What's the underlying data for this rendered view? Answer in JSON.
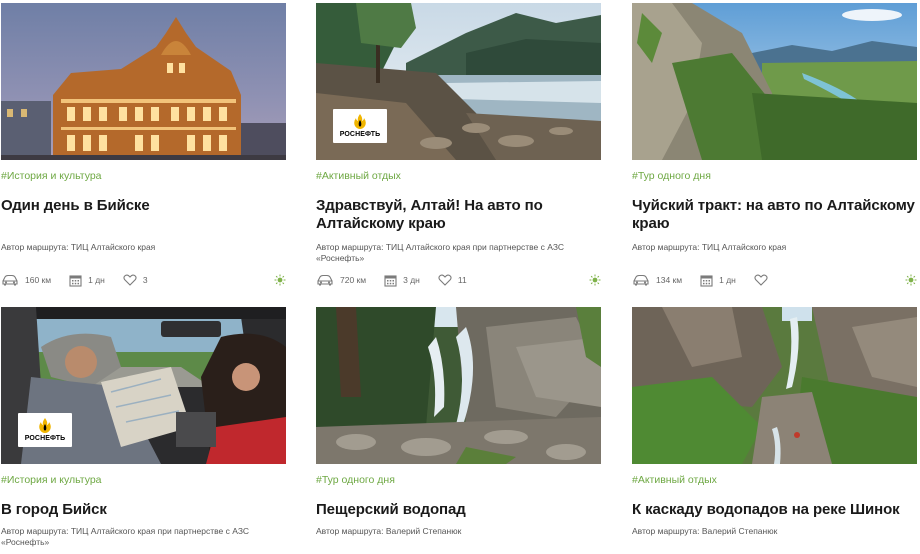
{
  "cards": [
    {
      "tag": "#История и культура",
      "title": "Один день в Бийске",
      "author": "Автор маршрута: ТИЦ Алтайского края",
      "distance": "160 км",
      "duration": "1 дн",
      "likes": "3",
      "sponsor_logo": false
    },
    {
      "tag": "#Активный отдых",
      "title": "Здравствуй, Алтай! На авто по Алтайскому краю",
      "author": "Автор маршрута: ТИЦ Алтайского края при партнерстве с АЗС «Роснефть»",
      "distance": "720 км",
      "duration": "3 дн",
      "likes": "11",
      "sponsor_logo": true
    },
    {
      "tag": "#Тур одного дня",
      "title": "Чуйский тракт: на авто по Алтайскому краю",
      "author": "Автор маршрута: ТИЦ Алтайского края",
      "distance": "134 км",
      "duration": "1 дн",
      "likes": "",
      "sponsor_logo": false
    },
    {
      "tag": "#История и культура",
      "title": "В город Бийск",
      "author": "Автор маршрута: ТИЦ Алтайского края при партнерстве с АЗС «Роснефть»",
      "sponsor_logo": true
    },
    {
      "tag": "#Тур одного дня",
      "title": "Пещерский водопад",
      "author": "Автор маршрута: Валерий Степанюк",
      "sponsor_logo": false
    },
    {
      "tag": "#Активный отдых",
      "title": "К каскаду водопадов на реке Шинок",
      "author": "Автор маршрута: Валерий Степанюк",
      "sponsor_logo": false
    }
  ],
  "sponsor": {
    "name": "РОСНЕФТЬ"
  },
  "icons": {
    "distance": "car-icon",
    "duration": "calendar-icon",
    "likes": "heart-icon",
    "weather": "sun-icon"
  },
  "colors": {
    "tag": "#6ea843",
    "icon": "#7b7b7b",
    "sun": "#7fb24a"
  }
}
